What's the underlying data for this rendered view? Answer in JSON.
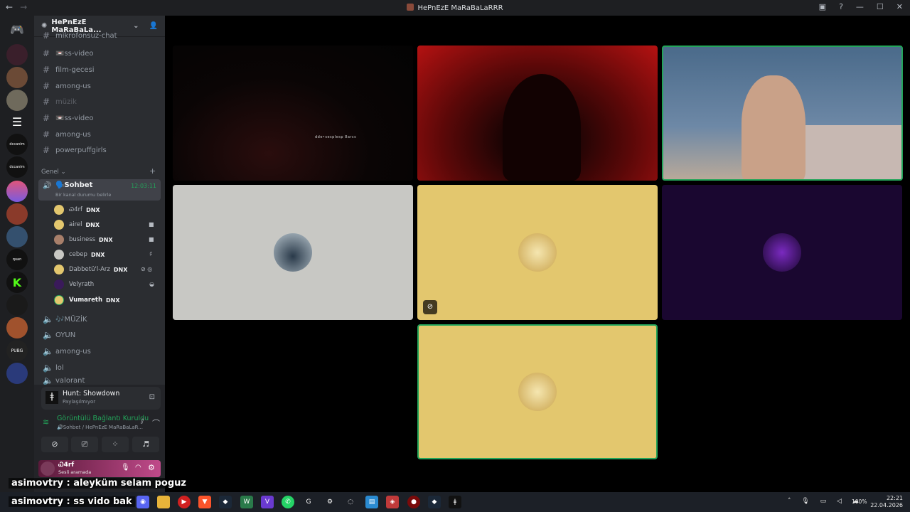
{
  "window": {
    "title": "HePnEzE MaRaBaLaRRR"
  },
  "server": {
    "name": "HePnEzE MaRaBaLa..."
  },
  "channels_top": [
    {
      "name": "mikrofonsuz-chat"
    },
    {
      "name": "📼ss-video"
    },
    {
      "name": "film-gecesi"
    },
    {
      "name": "among-us"
    },
    {
      "name": "müzik"
    },
    {
      "name": "📼ss-video"
    },
    {
      "name": "among-us"
    },
    {
      "name": "powerpuffgirls"
    }
  ],
  "category": {
    "name": "Genel"
  },
  "active_voice": {
    "name": "🗣️Sohbet",
    "timer": "12:03:11",
    "status": "Bir kanal durumu belirle"
  },
  "voice_users": [
    {
      "name": "Ꮗ4rf",
      "tag": "DNX"
    },
    {
      "name": "airel",
      "tag": "DNX"
    },
    {
      "name": "business",
      "tag": "DNX"
    },
    {
      "name": "cebep",
      "tag": "DNX"
    },
    {
      "name": "Dabbetü'l-Arz",
      "tag": "DNX"
    },
    {
      "name": "Velyrath",
      "tag": ""
    },
    {
      "name": "Vumareth",
      "tag": "DNX"
    }
  ],
  "voice_channels": [
    {
      "name": "🎶MÜZİK"
    },
    {
      "name": "OYUN"
    },
    {
      "name": "among-us"
    },
    {
      "name": "lol"
    },
    {
      "name": "valorant"
    }
  ],
  "activity": {
    "title": "Hunt: Showdown",
    "subtitle": "Paylaşılmıyor"
  },
  "connection": {
    "title": "Görüntülü Bağlantı Kuruldu",
    "subtitle": "🔊Sohbet / HePnEzE MaRaBaLaR..."
  },
  "me": {
    "name": "Ꮗ4rf",
    "status": "Sesli aramada"
  },
  "video_caption": "dde•sesplesp 8arcs",
  "chat_overlay": [
    "asimovtry : aleyküm selam poguz",
    "asimovtry : ss vido bak"
  ],
  "tray": {
    "battery": "100%",
    "time": "22:21",
    "date": "22.04.2026"
  },
  "colors": {
    "tile_gray": "#c8c8c4",
    "tile_gold": "#e3c76e",
    "tile_purple": "#1a0730",
    "speaking": "#23a55a",
    "accent": "#5865f2"
  }
}
